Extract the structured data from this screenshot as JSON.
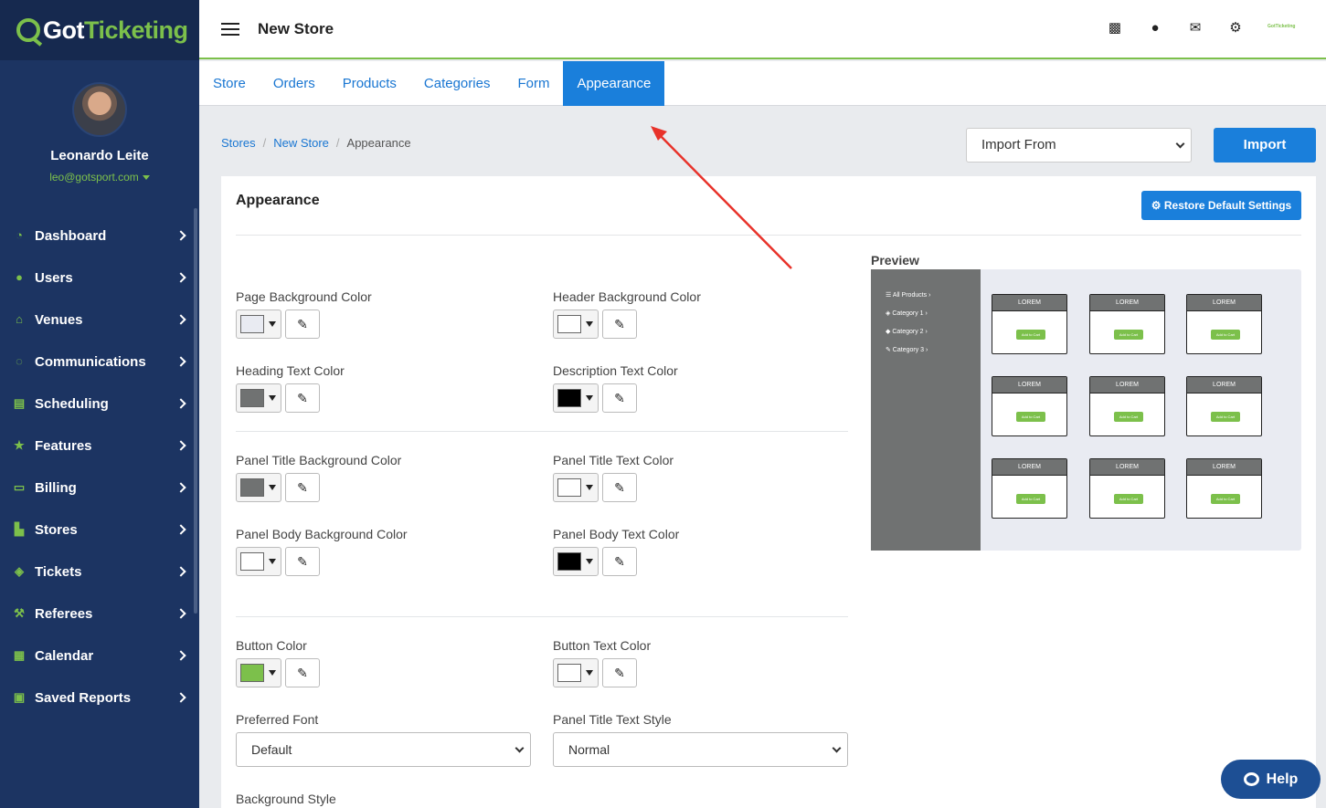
{
  "brand": {
    "logo_prefix": "Got",
    "logo_accent": "Ticketing"
  },
  "user": {
    "name": "Leonardo Leite",
    "email": "leo@gotsport.com"
  },
  "nav": [
    {
      "label": "Dashboard",
      "icon": "dashboard-icon"
    },
    {
      "label": "Users",
      "icon": "users-icon"
    },
    {
      "label": "Venues",
      "icon": "venues-icon"
    },
    {
      "label": "Communications",
      "icon": "communications-icon"
    },
    {
      "label": "Scheduling",
      "icon": "scheduling-icon"
    },
    {
      "label": "Features",
      "icon": "star-icon"
    },
    {
      "label": "Billing",
      "icon": "billing-icon"
    },
    {
      "label": "Stores",
      "icon": "stores-icon"
    },
    {
      "label": "Tickets",
      "icon": "ticket-icon"
    },
    {
      "label": "Referees",
      "icon": "gavel-icon"
    },
    {
      "label": "Calendar",
      "icon": "calendar-icon"
    },
    {
      "label": "Saved Reports",
      "icon": "save-icon"
    }
  ],
  "header": {
    "title": "New Store",
    "mini_logo": "GotTicketing"
  },
  "tabs": [
    "Store",
    "Orders",
    "Products",
    "Categories",
    "Form",
    "Appearance"
  ],
  "breadcrumb": {
    "stores": "Stores",
    "store": "New Store",
    "current": "Appearance"
  },
  "import": {
    "select_value": "Import From",
    "button": "Import"
  },
  "panel": {
    "title": "Appearance",
    "restore_button": "⚙ Restore Default Settings",
    "fields": {
      "page_bg": {
        "label": "Page Background Color",
        "color": "#e9ebf2"
      },
      "header_bg": {
        "label": "Header Background Color",
        "color": "#ffffff"
      },
      "heading_text": {
        "label": "Heading Text Color",
        "color": "#707272"
      },
      "description_text": {
        "label": "Description Text Color",
        "color": "#000000"
      },
      "panel_title_bg": {
        "label": "Panel Title Background Color",
        "color": "#707272"
      },
      "panel_title_text": {
        "label": "Panel Title Text Color",
        "color": "#ffffff"
      },
      "panel_body_bg": {
        "label": "Panel Body Background Color",
        "color": "#ffffff"
      },
      "panel_body_text": {
        "label": "Panel Body Text Color",
        "color": "#000000"
      },
      "button_color": {
        "label": "Button Color",
        "color": "#7cc04b"
      },
      "button_text": {
        "label": "Button Text Color",
        "color": "#ffffff"
      }
    },
    "preferred_font": {
      "label": "Preferred Font",
      "value": "Default"
    },
    "panel_title_style": {
      "label": "Panel Title Text Style",
      "value": "Normal"
    },
    "background_style": {
      "label": "Background Style"
    }
  },
  "preview": {
    "label": "Preview",
    "categories": [
      "☰ All Products ›",
      "◈ Category 1 ›",
      "◆ Category 2 ›",
      "✎ Category 3 ›"
    ],
    "card_title": "LOREM",
    "card_button": "Add to Cart"
  },
  "help": {
    "label": "Help"
  }
}
